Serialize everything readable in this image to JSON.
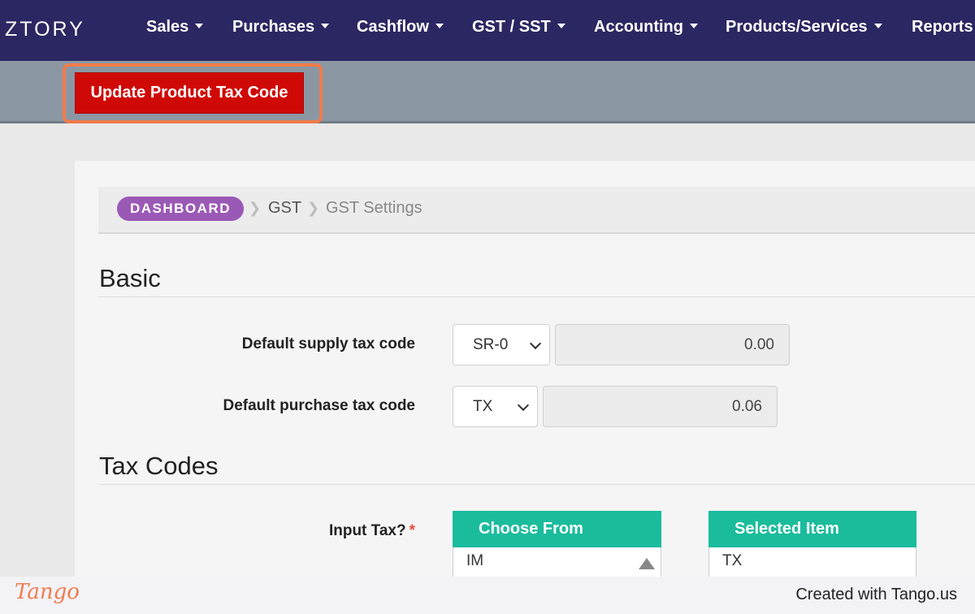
{
  "app": {
    "brand": "ZTORY"
  },
  "nav": {
    "items": [
      {
        "label": "Sales",
        "has_caret": true
      },
      {
        "label": "Purchases",
        "has_caret": true
      },
      {
        "label": "Cashflow",
        "has_caret": true
      },
      {
        "label": "GST / SST",
        "has_caret": true
      },
      {
        "label": "Accounting",
        "has_caret": true
      },
      {
        "label": "Products/Services",
        "has_caret": true
      },
      {
        "label": "Reports",
        "has_caret": false
      }
    ]
  },
  "toolbar": {
    "update_label": "Update Product Tax Code"
  },
  "breadcrumb": {
    "items": [
      "DASHBOARD",
      "GST",
      "GST Settings"
    ]
  },
  "basic": {
    "title": "Basic",
    "supply": {
      "label": "Default supply tax code",
      "selected": "SR-0",
      "value": "0.00"
    },
    "purchase": {
      "label": "Default purchase tax code",
      "selected": "TX",
      "value": "0.06"
    }
  },
  "tax_codes": {
    "title": "Tax Codes",
    "input_tax_label": "Input Tax?",
    "required_mark": "*",
    "choose_from": {
      "header": "Choose From",
      "first_item": "IM"
    },
    "selected_item": {
      "header": "Selected Item",
      "first_item": "TX"
    }
  },
  "footer": {
    "logo": "Tango",
    "text": "Created with Tango.us"
  },
  "colors": {
    "nav_bg": "#2b2762",
    "accent_red": "#cf0a06",
    "highlight_orange": "#f07c4c",
    "list_header_teal": "#1abc9c",
    "breadcrumb_purple": "#9b59b6"
  },
  "icons": {
    "dropdown": "chevron-down-icon",
    "caret": "caret-down-icon",
    "scroll": "scroll-up-arrow-icon",
    "breadcrumb_separator": "chevron-right-icon"
  }
}
